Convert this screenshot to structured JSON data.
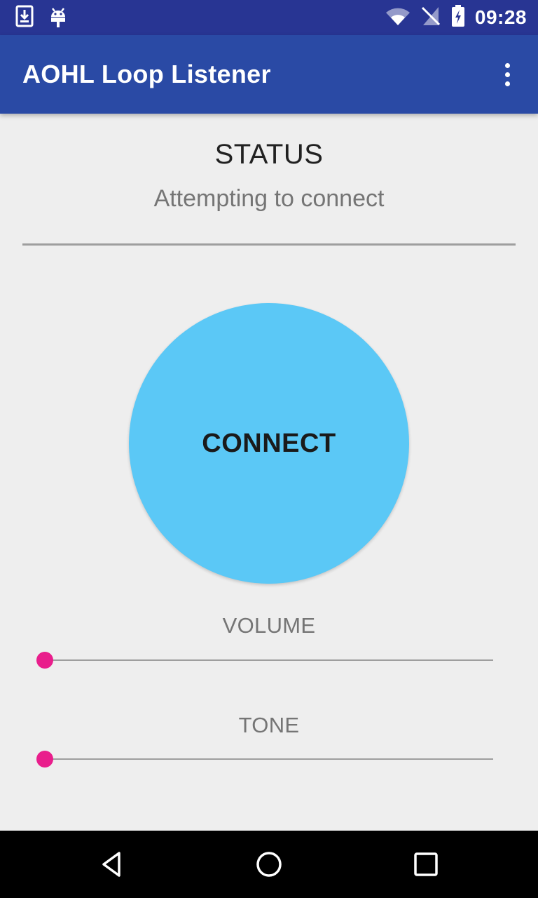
{
  "status_bar": {
    "time": "09:28",
    "icons": [
      "download-icon",
      "android-debug-icon",
      "wifi-icon",
      "no-sim-icon",
      "battery-charging-icon"
    ]
  },
  "app_bar": {
    "title": "AOHL Loop Listener",
    "menu_icon": "more-vert-icon"
  },
  "main": {
    "status_label": "STATUS",
    "status_text": "Attempting to connect",
    "connect_label": "CONNECT",
    "connect_color": "#5bc8f6",
    "volume": {
      "label": "VOLUME",
      "value": 0
    },
    "tone": {
      "label": "TONE",
      "value": 0
    },
    "accent_color": "#e91e8c"
  },
  "nav_bar": {
    "icons": [
      "back-icon",
      "home-icon",
      "recents-icon"
    ]
  }
}
